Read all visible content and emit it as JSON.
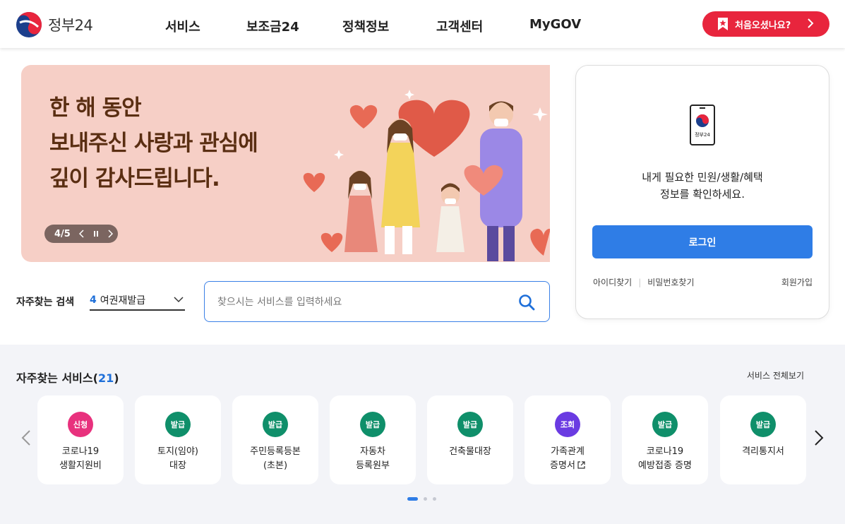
{
  "header": {
    "logo_text": "정부24",
    "nav": [
      {
        "label": "서비스"
      },
      {
        "label": "보조금24"
      },
      {
        "label": "정책정보"
      },
      {
        "label": "고객센터"
      },
      {
        "label": "MyGOV"
      }
    ],
    "first_visit_button": "처음오셨나요?"
  },
  "banner": {
    "lines": [
      "한 해 동안",
      "보내주신 사랑과 관심에",
      "깊이 감사드립니다."
    ],
    "counter": "4/5"
  },
  "search": {
    "freq_label": "자주찾는 검색",
    "freq_number": "4",
    "freq_value": "여권재발급",
    "placeholder": "찾으시는 서비스를 입력하세요"
  },
  "login": {
    "logo_caption": "정부24",
    "message_line1": "내게 필요한 민원/생활/혜택",
    "message_line2": "정보를 확인하세요.",
    "button": "로그인",
    "find_id": "아이디찾기",
    "find_pw": "비밀번호찾기",
    "signup": "회원가입"
  },
  "services": {
    "title": "자주찾는 서비스(",
    "count": "21",
    "title_close": ")",
    "view_all": "서비스 전체보기",
    "items": [
      {
        "badge": "신청",
        "color": "#e8317d",
        "line1": "코로나19",
        "line2": "생활지원비",
        "external": false
      },
      {
        "badge": "발급",
        "color": "#0f8f6a",
        "line1": "토지(임야)",
        "line2": "대장",
        "external": false
      },
      {
        "badge": "발급",
        "color": "#0f8f6a",
        "line1": "주민등록등본",
        "line2": "(초본)",
        "external": false
      },
      {
        "badge": "발급",
        "color": "#0f8f6a",
        "line1": "자동차",
        "line2": "등록원부",
        "external": false
      },
      {
        "badge": "발급",
        "color": "#0f8f6a",
        "line1": "건축물대장",
        "line2": "",
        "external": false
      },
      {
        "badge": "조회",
        "color": "#6a3be2",
        "line1": "가족관계",
        "line2": "증명서",
        "external": true
      },
      {
        "badge": "발급",
        "color": "#0f8f6a",
        "line1": "코로나19",
        "line2": "예방접종 증명",
        "external": false
      },
      {
        "badge": "발급",
        "color": "#0f8f6a",
        "line1": "격리통지서",
        "line2": "",
        "external": false
      }
    ],
    "pagination": {
      "pages": 3,
      "active": 1
    }
  }
}
